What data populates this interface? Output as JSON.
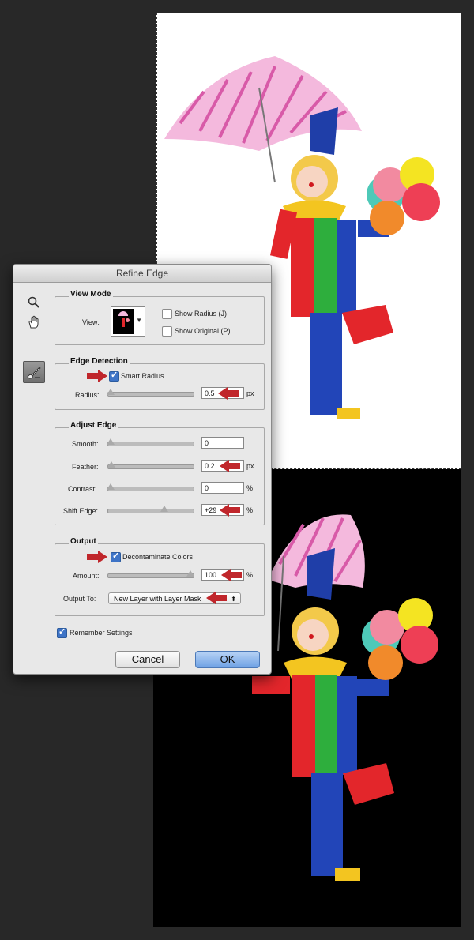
{
  "dialog": {
    "title": "Refine Edge",
    "view_mode": {
      "title": "View Mode",
      "view_label": "View:",
      "show_radius": "Show Radius (J)",
      "show_original": "Show Original (P)",
      "show_radius_checked": false,
      "show_original_checked": false
    },
    "edge_detection": {
      "title": "Edge Detection",
      "smart_radius": "Smart Radius",
      "smart_radius_checked": true,
      "radius_label": "Radius:",
      "radius_value": "0.5",
      "radius_unit": "px",
      "radius_slider": 0.02
    },
    "adjust_edge": {
      "title": "Adjust Edge",
      "rows": [
        {
          "label": "Smooth:",
          "value": "0",
          "unit": "",
          "slider": 0.0
        },
        {
          "label": "Feather:",
          "value": "0.2",
          "unit": "px",
          "slider": 0.01
        },
        {
          "label": "Contrast:",
          "value": "0",
          "unit": "%",
          "slider": 0.0
        },
        {
          "label": "Shift Edge:",
          "value": "+29",
          "unit": "%",
          "slider": 0.65
        }
      ]
    },
    "output": {
      "title": "Output",
      "decontaminate": "Decontaminate Colors",
      "decontaminate_checked": true,
      "amount_label": "Amount:",
      "amount_value": "100",
      "amount_unit": "%",
      "amount_slider": 1.0,
      "output_to_label": "Output To:",
      "output_to_value": "New Layer with Layer Mask"
    },
    "remember": "Remember Settings",
    "remember_checked": true,
    "cancel": "Cancel",
    "ok": "OK"
  },
  "colors": {
    "accent": "#3e74c7",
    "arrow": "#c0262b",
    "canvas_dark": "#000000",
    "canvas_light": "#ffffff"
  },
  "icons": [
    "zoom-icon",
    "hand-icon",
    "refine-radius-brush-icon",
    "red-arrow-icon"
  ]
}
